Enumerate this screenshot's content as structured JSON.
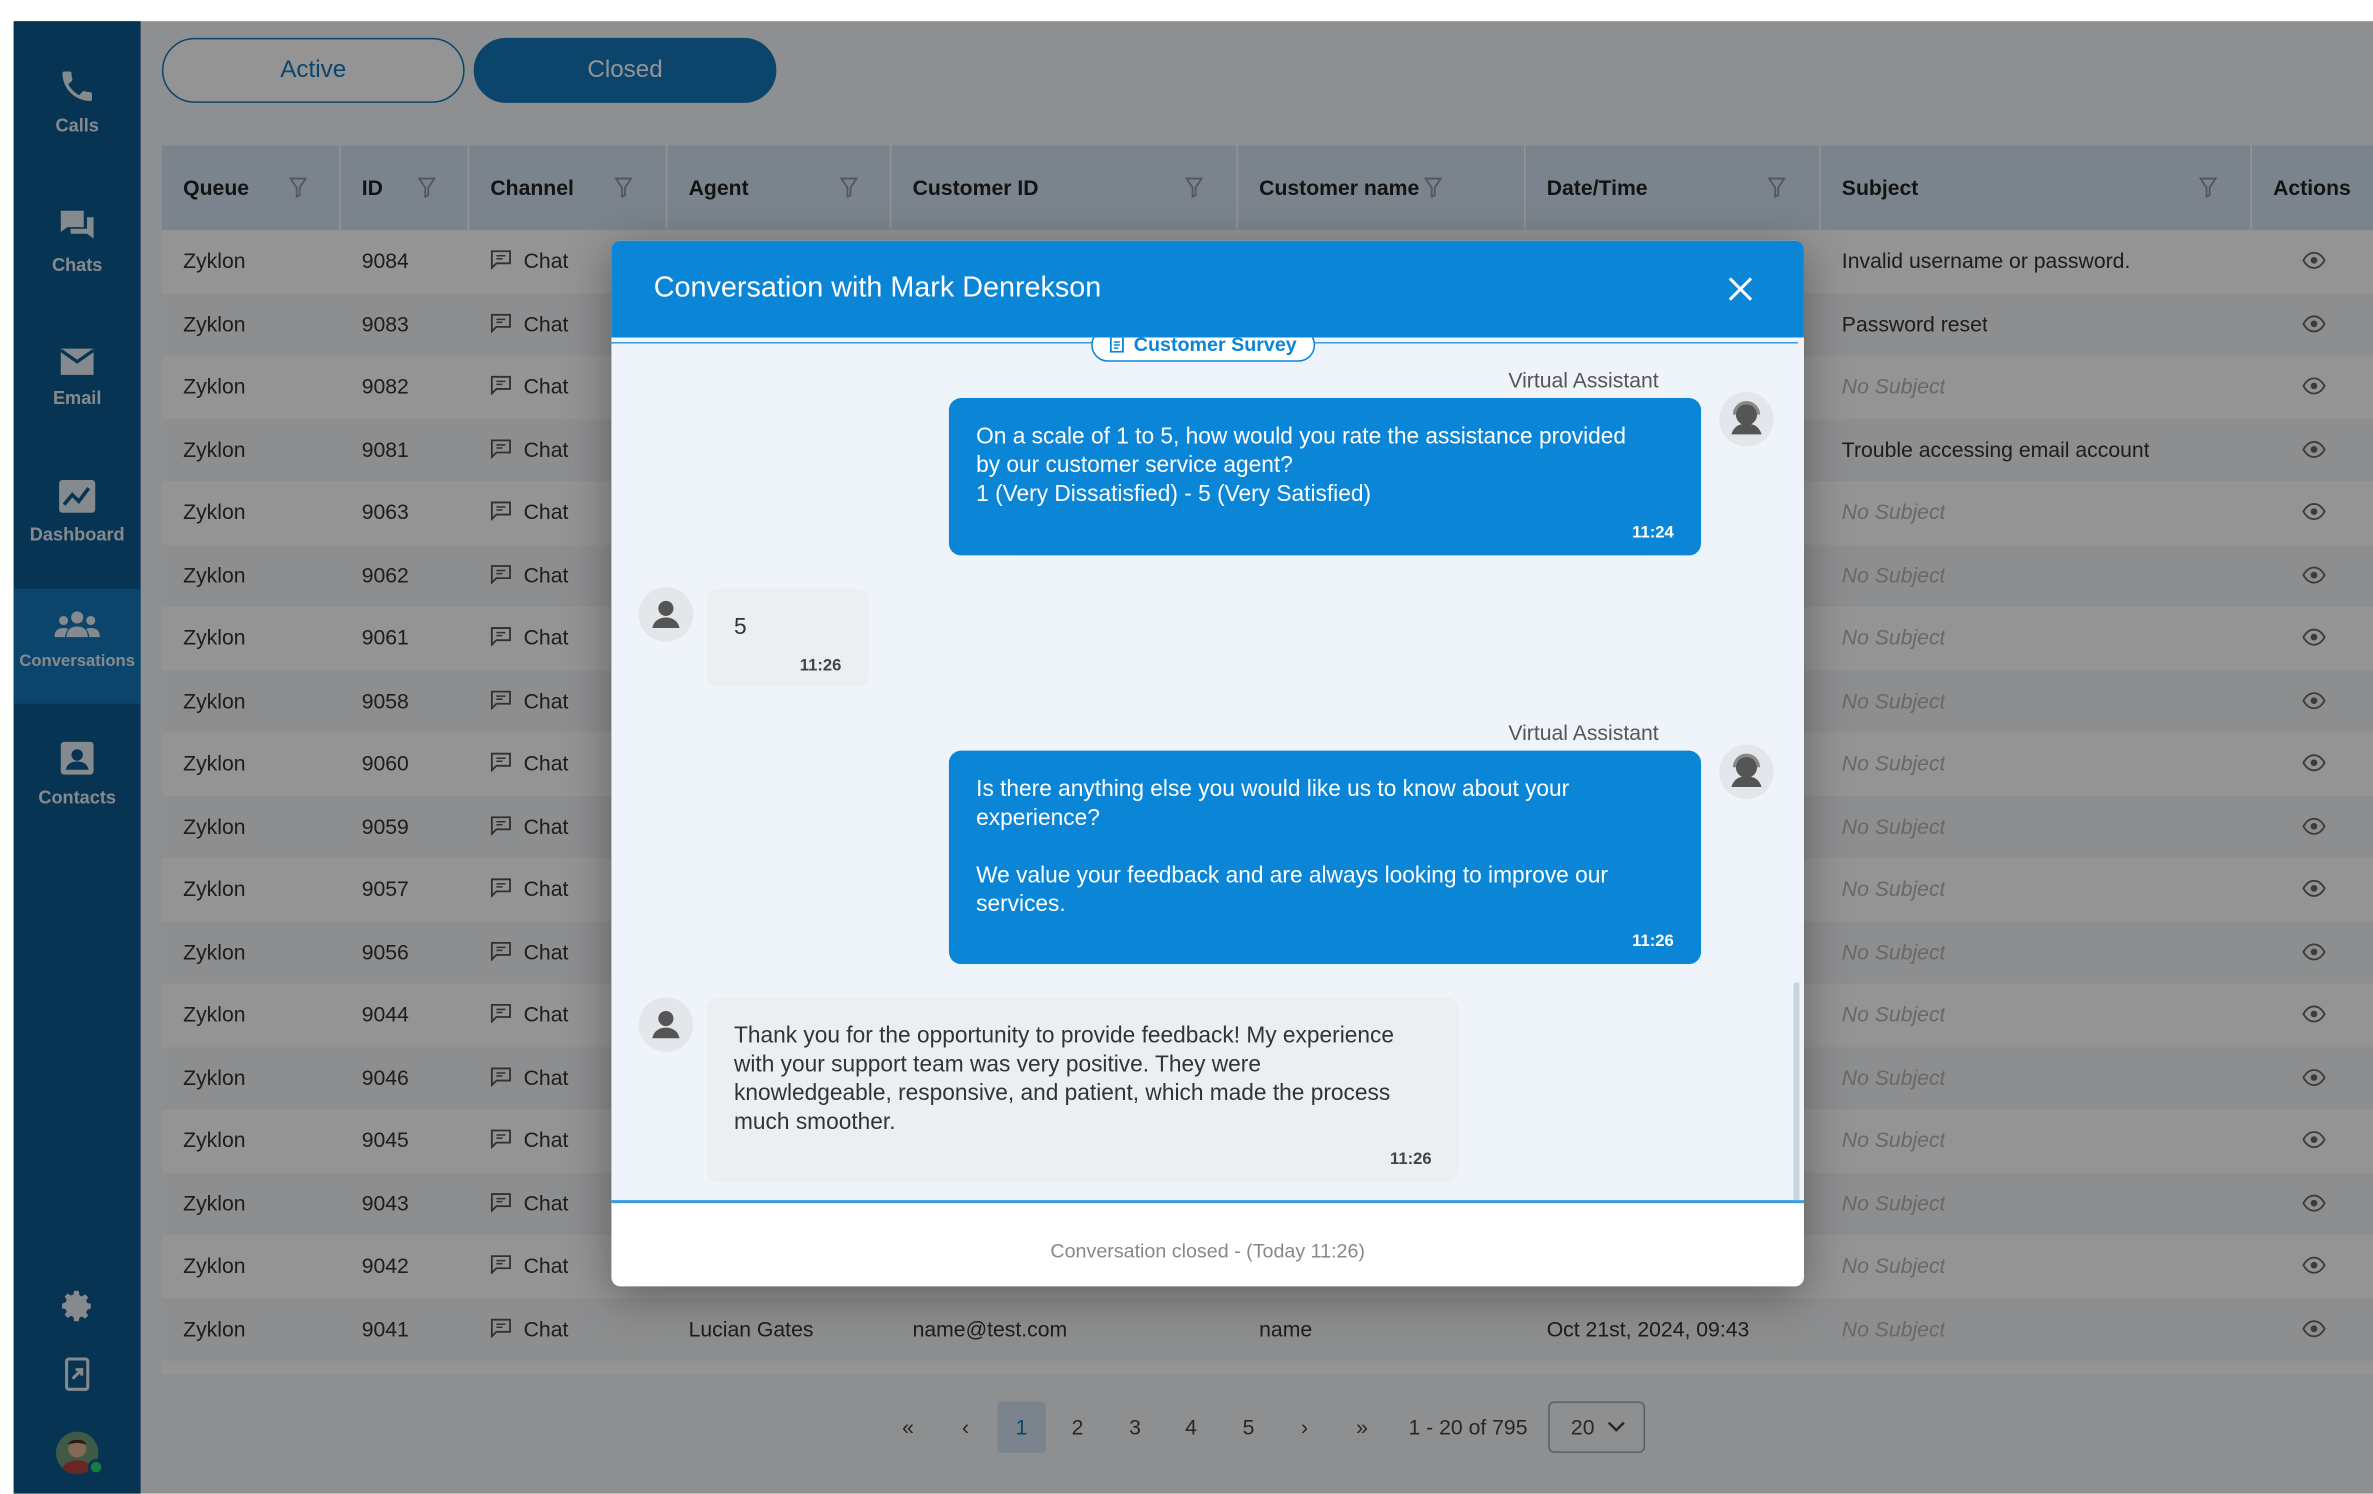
{
  "sidebar": {
    "items": [
      {
        "label": "Calls",
        "icon": "phone-icon"
      },
      {
        "label": "Chats",
        "icon": "chats-icon"
      },
      {
        "label": "Email",
        "icon": "envelope-icon"
      },
      {
        "label": "Dashboard",
        "icon": "chart-icon"
      },
      {
        "label": "Conversations",
        "icon": "people-icon",
        "active": true
      },
      {
        "label": "Contacts",
        "icon": "contact-card-icon"
      }
    ],
    "bottom_icons": [
      "gear-icon",
      "logout-icon",
      "avatar"
    ]
  },
  "tabs": {
    "active": "Active",
    "closed": "Closed"
  },
  "table": {
    "headers": [
      "Queue",
      "ID",
      "Channel",
      "Agent",
      "Customer ID",
      "Customer name",
      "Date/Time",
      "Subject",
      "Actions"
    ],
    "rows": [
      {
        "queue": "Zyklon",
        "id": "9084",
        "channel": "Chat",
        "subject": "Invalid username or password."
      },
      {
        "queue": "Zyklon",
        "id": "9083",
        "channel": "Chat",
        "subject": "Password reset"
      },
      {
        "queue": "Zyklon",
        "id": "9082",
        "channel": "Chat",
        "subject": "No Subject"
      },
      {
        "queue": "Zyklon",
        "id": "9081",
        "channel": "Chat",
        "subject": "Trouble accessing email account"
      },
      {
        "queue": "Zyklon",
        "id": "9063",
        "channel": "Chat",
        "subject": "No Subject"
      },
      {
        "queue": "Zyklon",
        "id": "9062",
        "channel": "Chat",
        "subject": "No Subject"
      },
      {
        "queue": "Zyklon",
        "id": "9061",
        "channel": "Chat",
        "subject": "No Subject"
      },
      {
        "queue": "Zyklon",
        "id": "9058",
        "channel": "Chat",
        "subject": "No Subject"
      },
      {
        "queue": "Zyklon",
        "id": "9060",
        "channel": "Chat",
        "subject": "No Subject"
      },
      {
        "queue": "Zyklon",
        "id": "9059",
        "channel": "Chat",
        "subject": "No Subject"
      },
      {
        "queue": "Zyklon",
        "id": "9057",
        "channel": "Chat",
        "subject": "No Subject"
      },
      {
        "queue": "Zyklon",
        "id": "9056",
        "channel": "Chat",
        "subject": "No Subject"
      },
      {
        "queue": "Zyklon",
        "id": "9044",
        "channel": "Chat",
        "subject": "No Subject"
      },
      {
        "queue": "Zyklon",
        "id": "9046",
        "channel": "Chat",
        "subject": "No Subject"
      },
      {
        "queue": "Zyklon",
        "id": "9045",
        "channel": "Chat",
        "subject": "No Subject"
      },
      {
        "queue": "Zyklon",
        "id": "9043",
        "channel": "Chat",
        "subject": "No Subject"
      },
      {
        "queue": "Zyklon",
        "id": "9042",
        "channel": "Chat",
        "subject": "No Subject"
      },
      {
        "queue": "Zyklon",
        "id": "9041",
        "channel": "Chat",
        "agent": "Lucian Gates",
        "customer_id": "name@test.com",
        "customer_name": "name",
        "datetime": "Oct 21st, 2024, 09:43",
        "subject": "No Subject"
      }
    ]
  },
  "pagination": {
    "first": "«",
    "prev": "‹",
    "pages": [
      "1",
      "2",
      "3",
      "4",
      "5"
    ],
    "current": "1",
    "next": "›",
    "last": "»",
    "range": "1 - 20 of 795",
    "page_size": "20"
  },
  "modal": {
    "title": "Conversation with Mark Denrekson",
    "survey_tag": "Customer Survey",
    "messages": [
      {
        "from": "Virtual Assistant",
        "direction": "out",
        "lines": [
          "On a scale of 1 to 5, how would you rate the assistance provided",
          "by our customer service agent?",
          "1 (Very Dissatisfied) - 5 (Very Satisfied)"
        ],
        "time": "11:24"
      },
      {
        "from": "customer",
        "direction": "in",
        "lines": [
          "5"
        ],
        "time": "11:26"
      },
      {
        "from": "Virtual Assistant",
        "direction": "out",
        "lines": [
          "Is there anything else you would like us to know about your",
          "experience?",
          "",
          "We value your feedback and are always looking to improve our",
          "services."
        ],
        "time": "11:26"
      },
      {
        "from": "customer",
        "direction": "in",
        "lines": [
          "Thank you for the opportunity to provide feedback! My experience",
          "with your support team was very positive. They were",
          "knowledgeable, responsive, and patient, which made the process",
          "much smoother."
        ],
        "time": "11:26"
      }
    ],
    "closed_note": "Conversation closed - (Today 11:26)"
  },
  "colors": {
    "sidebar": "#0d5a8e",
    "accent": "#1477b8",
    "modal_header": "#0b86d6",
    "table_header": "#d4e4f1"
  }
}
